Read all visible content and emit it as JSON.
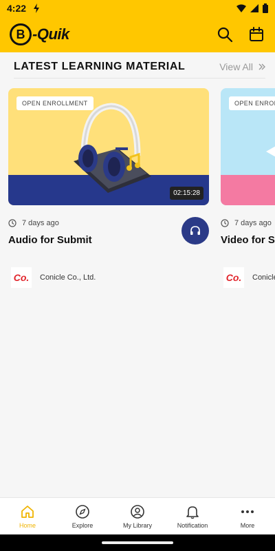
{
  "status_bar": {
    "time": "4:22"
  },
  "app_bar": {
    "logo_badge": "B",
    "logo_text": "-Quik"
  },
  "section": {
    "title": "LATEST LEARNING MATERIAL",
    "view_all": "View All"
  },
  "cards": [
    {
      "badge": "OPEN ENROLLMENT",
      "duration": "02:15:28",
      "meta": "7 days ago",
      "title": "Audio for Submit",
      "provider_logo": "Co.",
      "provider_name": "Conicle Co., Ltd.",
      "colors": {
        "top": "#ffe07a",
        "bottom": "#26388c"
      }
    },
    {
      "badge": "OPEN ENROLLMENT",
      "meta": "7 days ago",
      "title": "Video for Submit",
      "provider_logo": "Co.",
      "provider_name": "Conicle Co., Ltd.",
      "colors": {
        "top": "#b9e6f7",
        "bottom": "#f47aa2"
      }
    }
  ],
  "bottom_nav": [
    {
      "label": "Home",
      "icon": "home-icon",
      "active": true
    },
    {
      "label": "Explore",
      "icon": "compass-icon",
      "active": false
    },
    {
      "label": "My Library",
      "icon": "user-circle-icon",
      "active": false
    },
    {
      "label": "Notification",
      "icon": "bell-icon",
      "active": false
    },
    {
      "label": "More",
      "icon": "more-dots-icon",
      "active": false
    }
  ],
  "colors": {
    "brand_yellow": "#ffc700",
    "accent_blue": "#2b3a87",
    "active_nav": "#f0b400"
  }
}
